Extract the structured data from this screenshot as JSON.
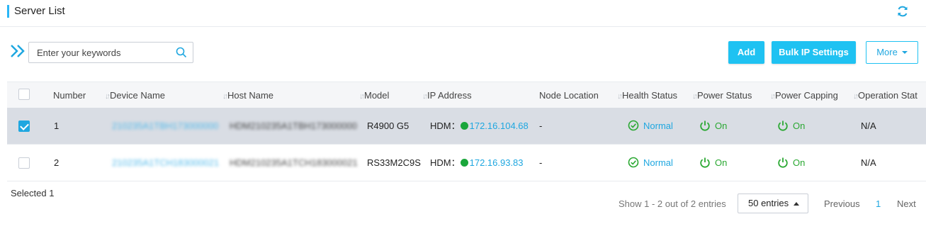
{
  "header": {
    "title": "Server List",
    "refresh_icon": "refresh-icon"
  },
  "toolbar": {
    "search_placeholder": "Enter your keywords",
    "search_value": "",
    "add_label": "Add",
    "bulk_ip_label": "Bulk IP Settings",
    "more_label": "More"
  },
  "table": {
    "columns": [
      "Number",
      "Device Name",
      "Host Name",
      "Model",
      "IP Address",
      "Node Location",
      "Health Status",
      "Power Status",
      "Power Capping",
      "Operation Stat"
    ],
    "rows": [
      {
        "selected": true,
        "number": "1",
        "device_name": "210235A1TBH173000000",
        "host_name": "HDM210235A1TBH173000000",
        "model": "R4900 G5",
        "ip_prefix": "HDM：",
        "ip": "172.16.104.68",
        "node_location": "-",
        "health": "Normal",
        "power": "On",
        "power_capping": "On",
        "operation": "N/A"
      },
      {
        "selected": false,
        "number": "2",
        "device_name": "210235A1TCH183000021",
        "host_name": "HDM210235A1TCH183000021",
        "model": "RS33M2C9S",
        "ip_prefix": "HDM：",
        "ip": "172.16.93.83",
        "node_location": "-",
        "health": "Normal",
        "power": "On",
        "power_capping": "On",
        "operation": "N/A"
      }
    ]
  },
  "footer": {
    "selected_label": "Selected",
    "selected_count": "1",
    "entries_info": "Show 1 - 2 out of 2 entries",
    "page_size": "50 entries",
    "prev_label": "Previous",
    "current_page": "1",
    "next_label": "Next"
  },
  "colors": {
    "accent": "#1fc2f2",
    "link": "#1fa7e0",
    "success": "#2aa832"
  }
}
